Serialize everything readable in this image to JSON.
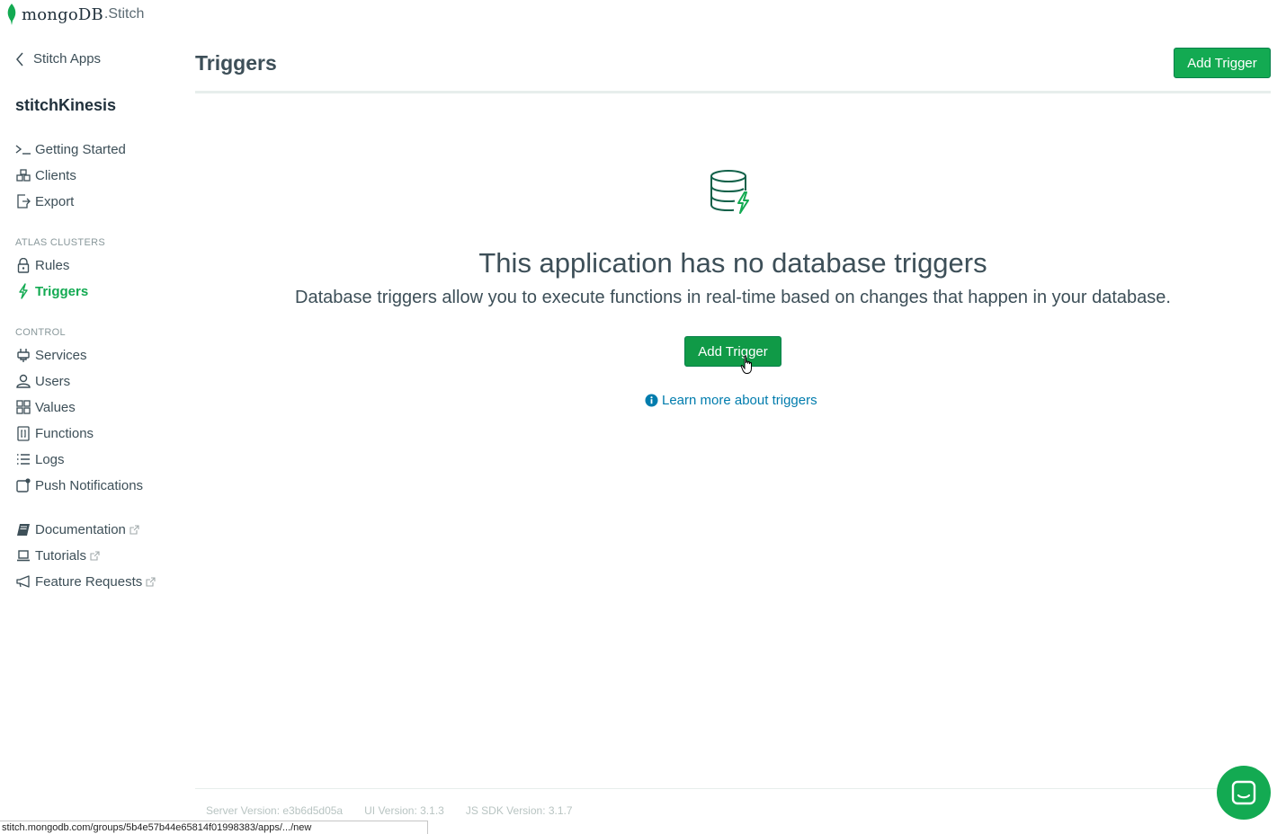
{
  "logo": {
    "brand": "mongoDB",
    "product": ".Stitch"
  },
  "sidebar": {
    "back_label": "Stitch Apps",
    "app_name": "stitchKinesis",
    "top_items": [
      {
        "label": "Getting Started",
        "icon": "terminal-icon"
      },
      {
        "label": "Clients",
        "icon": "clients-icon"
      },
      {
        "label": "Export",
        "icon": "export-icon"
      }
    ],
    "atlas_label": "ATLAS CLUSTERS",
    "atlas_items": [
      {
        "label": "Rules",
        "icon": "lock-icon"
      },
      {
        "label": "Triggers",
        "icon": "bolt-icon",
        "active": true
      }
    ],
    "control_label": "CONTROL",
    "control_items": [
      {
        "label": "Services",
        "icon": "plug-icon"
      },
      {
        "label": "Users",
        "icon": "user-icon"
      },
      {
        "label": "Values",
        "icon": "grid-icon"
      },
      {
        "label": "Functions",
        "icon": "function-file-icon"
      },
      {
        "label": "Logs",
        "icon": "list-icon"
      },
      {
        "label": "Push Notifications",
        "icon": "notification-icon"
      }
    ],
    "resource_items": [
      {
        "label": "Documentation",
        "icon": "book-icon"
      },
      {
        "label": "Tutorials",
        "icon": "laptop-icon"
      },
      {
        "label": "Feature Requests",
        "icon": "megaphone-icon"
      }
    ]
  },
  "main": {
    "title": "Triggers",
    "add_button": "Add Trigger",
    "empty_title": "This application has no database triggers",
    "empty_description": "Database triggers allow you to execute functions in real-time based on changes that happen in your database.",
    "center_button": "Add Trigger",
    "learn_link": "Learn more about triggers"
  },
  "footer": {
    "server_version": "Server Version: e3b6d5d05a",
    "ui_version": "UI Version: 3.1.3",
    "sdk_version": "JS SDK Version: 3.1.7"
  },
  "status_url": "stitch.mongodb.com/groups/5b4e57b44e65814f01998383/apps/.../new",
  "colors": {
    "accent": "#13aa52",
    "link": "#007cad",
    "text": "#3d4f58"
  }
}
